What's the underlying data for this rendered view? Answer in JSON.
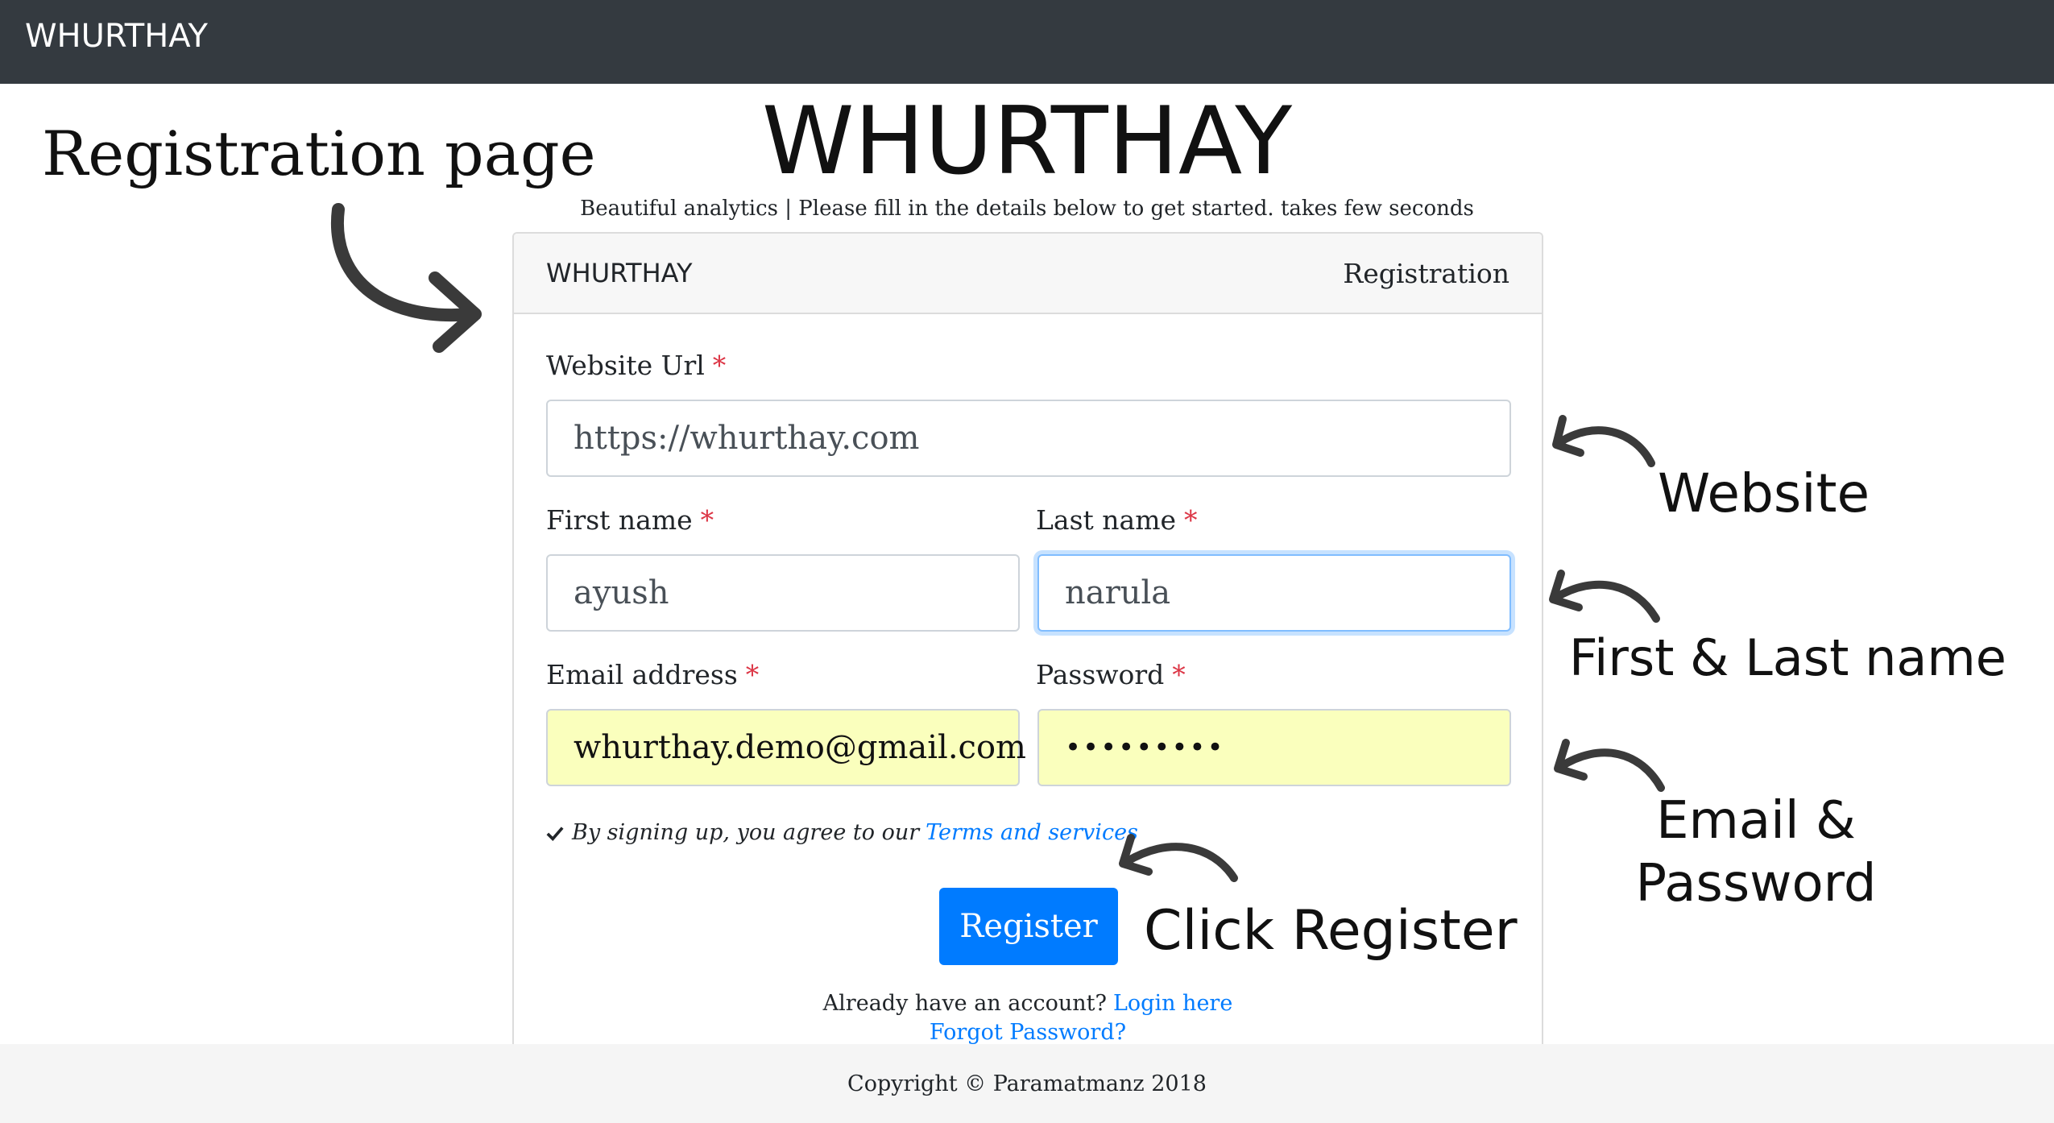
{
  "navbar": {
    "brand": "WHURTHAY"
  },
  "hero": {
    "title": "WHURTHAY",
    "subtitle": "Beautiful analytics | Please fill in the details below to get started. takes few seconds"
  },
  "card": {
    "brand": "WHURTHAY",
    "title": "Registration",
    "fields": {
      "website": {
        "label": "Website Url",
        "required": "*",
        "value": "https://whurthay.com"
      },
      "first_name": {
        "label": "First name",
        "required": "*",
        "value": "ayush"
      },
      "last_name": {
        "label": "Last name",
        "required": "*",
        "value": "narula"
      },
      "email": {
        "label": "Email address",
        "required": "*",
        "value": "whurthay.demo@gmail.com"
      },
      "password": {
        "label": "Password",
        "required": "*",
        "value": "•••••••••"
      }
    },
    "terms_text": "By signing up, you agree to our",
    "terms_link": "Terms and services",
    "register_label": "Register",
    "login_prompt": "Already have an account?",
    "login_link": "Login here",
    "forgot_link": "Forgot Password?"
  },
  "footer": {
    "copyright": "Copyright © Paramatmanz 2018"
  },
  "annotations": {
    "registration_page": "Registration page",
    "website": "Website",
    "first_last_name": "First & Last name",
    "email_password_line1": "Email &",
    "email_password_line2": "Password",
    "click_register": "Click Register"
  },
  "colors": {
    "navbar_bg": "#343a40",
    "primary": "#007bff",
    "required": "#dc3545",
    "autofill_bg": "#faffbd",
    "focus_border": "#80bdff",
    "footer_bg": "#f5f5f5"
  },
  "icons": {
    "checkmark": "check-icon",
    "annotation_arrow": "curved-arrow-icon"
  }
}
